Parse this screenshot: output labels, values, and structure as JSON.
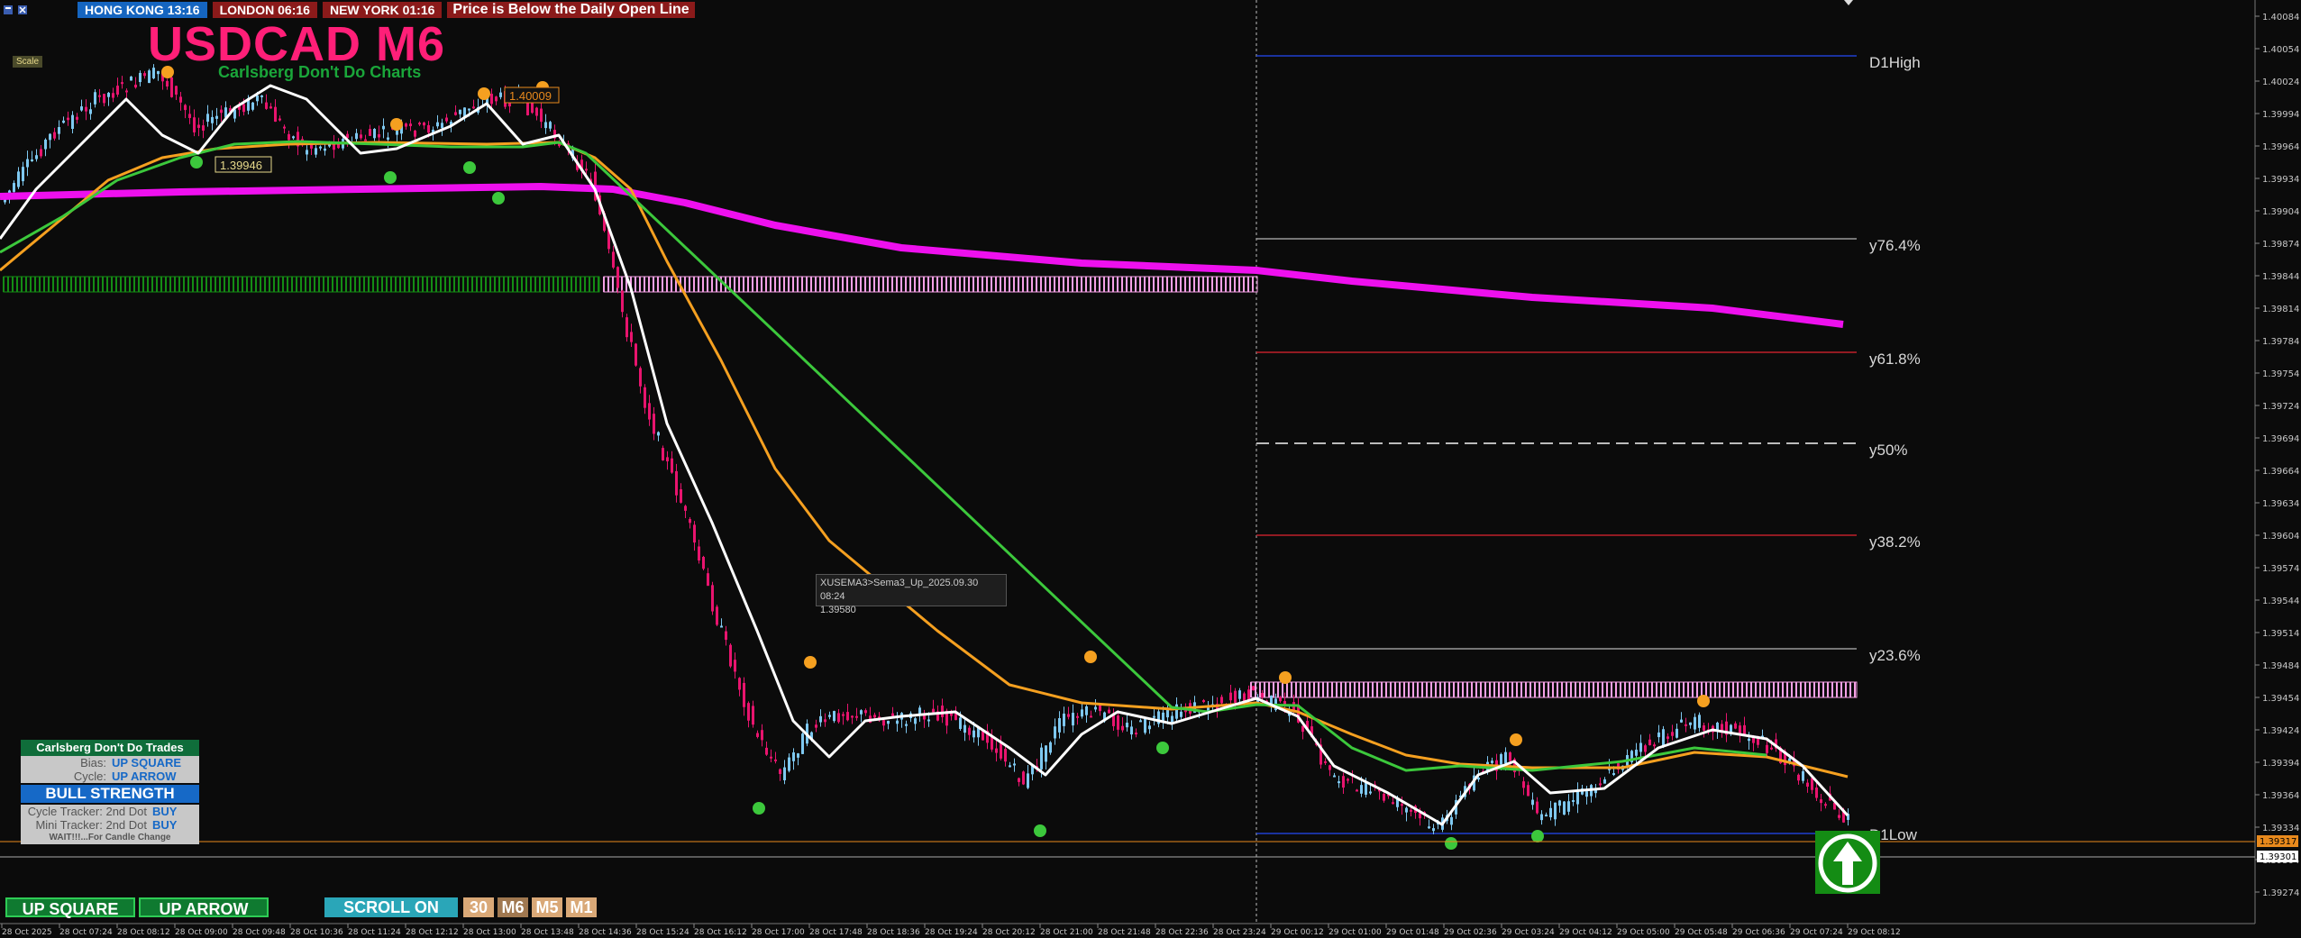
{
  "window": {
    "title": "USDCAD M6",
    "subtitle": "Carlsberg Don't Do Charts",
    "scale_label": "Scale"
  },
  "sessions": [
    {
      "label": "HONG KONG 13:16"
    },
    {
      "label": "LONDON  06:16"
    },
    {
      "label": "NEW YORK  01:16"
    }
  ],
  "alert": "Price is Below the Daily Open Line",
  "price_axis": {
    "ticks": [
      "1.40084",
      "1.40054",
      "1.40024",
      "1.39994",
      "1.39964",
      "1.39934",
      "1.39904",
      "1.39874",
      "1.39844",
      "1.39814",
      "1.39784",
      "1.39754",
      "1.39724",
      "1.39694",
      "1.39664",
      "1.39634",
      "1.39604",
      "1.39574",
      "1.39544",
      "1.39514",
      "1.39484",
      "1.39454",
      "1.39424",
      "1.39394",
      "1.39364",
      "1.39334",
      "1.39304",
      "1.39274"
    ],
    "current_price": "1.39317",
    "alt_price": "1.39301",
    "current_color": "#e8891c"
  },
  "time_axis": {
    "ticks": [
      "28 Oct 2025",
      "28 Oct 07:24",
      "28 Oct 08:12",
      "28 Oct 09:00",
      "28 Oct 09:48",
      "28 Oct 10:36",
      "28 Oct 11:24",
      "28 Oct 12:12",
      "28 Oct 13:00",
      "28 Oct 13:48",
      "28 Oct 14:36",
      "28 Oct 15:24",
      "28 Oct 16:12",
      "28 Oct 17:00",
      "28 Oct 17:48",
      "28 Oct 18:36",
      "28 Oct 19:24",
      "28 Oct 20:12",
      "28 Oct 21:00",
      "28 Oct 21:48",
      "28 Oct 22:36",
      "28 Oct 23:24",
      "29 Oct 00:12",
      "29 Oct 01:00",
      "29 Oct 01:48",
      "29 Oct 02:36",
      "29 Oct 03:24",
      "29 Oct 04:12",
      "29 Oct 05:00",
      "29 Oct 05:48",
      "29 Oct 06:36",
      "29 Oct 07:24",
      "29 Oct 08:12"
    ]
  },
  "levels": [
    {
      "label": "D1High",
      "color": "#1f3fd0"
    },
    {
      "label": "y76.4%",
      "color": "#9a9a9a"
    },
    {
      "label": "y61.8%",
      "color": "#c0202a"
    },
    {
      "label": "y50%",
      "color": "#bbbbbb"
    },
    {
      "label": "y38.2%",
      "color": "#c0202a"
    },
    {
      "label": "y23.6%",
      "color": "#9a9a9a"
    },
    {
      "label": "D1Low",
      "color": "#1f3fd0"
    }
  ],
  "price_labels": [
    "1.39946",
    "1.40009"
  ],
  "tooltip": {
    "line1": "XUSEMA3>Sema3_Up_2025.09.30 08:24",
    "line2": "1.39580"
  },
  "panel": {
    "header": "Carlsberg Don't Do Trades",
    "bias_label": "Bias:",
    "bias_value": "UP SQUARE",
    "cycle_label": "Cycle:",
    "cycle_value": "UP ARROW",
    "strength": "BULL STRENGTH",
    "cycle_tracker_label": "Cycle Tracker: 2nd Dot",
    "cycle_tracker_value": "BUY",
    "mini_tracker_label": "Mini Tracker: 2nd Dot",
    "mini_tracker_value": "BUY",
    "wait": "WAIT!!!...For Candle Change"
  },
  "buttons": {
    "up_square": "UP SQUARE",
    "up_arrow": "UP ARROW",
    "scroll": "SCROLL ON",
    "tf30": "30",
    "tfM6": "M6",
    "tfM5": "M5",
    "tfM1": "M1"
  },
  "colors": {
    "bull": "#7ec8f0",
    "bear": "#e8146e",
    "ema_white": "#ffffff",
    "ema_orange": "#f5a020",
    "ema_green": "#3cc83c",
    "ema_magenta": "#ee10ee",
    "bull_band": "#148c14",
    "bear_band": "#f5a0e6"
  },
  "icons": {
    "buy_signal": "up-arrow-circle-icon",
    "cursor": "crosshair-icon"
  }
}
